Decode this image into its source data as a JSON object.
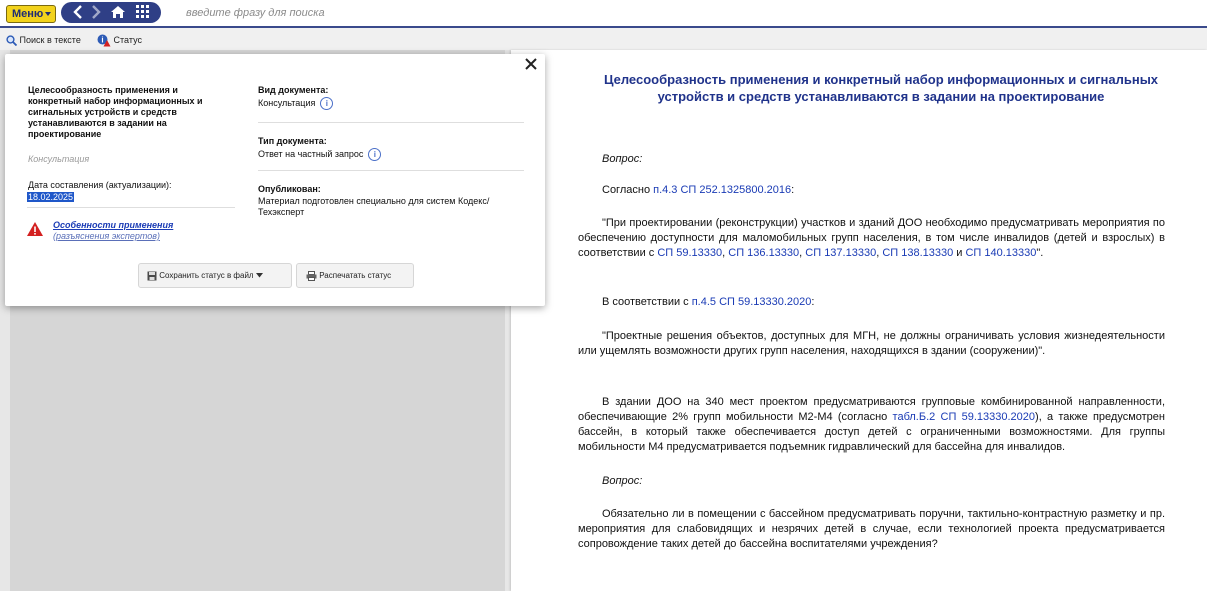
{
  "topbar": {
    "menu_label": "Меню",
    "search_placeholder": "введите фразу для поиска"
  },
  "toolbar": {
    "search_in_text": "Поиск в тексте",
    "status": "Статус"
  },
  "popup": {
    "doc_title": "Целесообразность применения и конкретный набор информационных и сигнальных устройств и средств устанавливаются в задании на проектирование",
    "doc_category": "Консультация",
    "date_label": "Дата составления (актуализации):",
    "date_value": "18.02.2025",
    "features_link": "Особенности применения",
    "features_sub": "(разъяснения экспертов)",
    "doc_kind_label": "Вид документа:",
    "doc_kind_value": "Консультация",
    "doc_type_label": "Тип документа:",
    "doc_type_value": "Ответ на частный запрос",
    "published_label": "Опубликован:",
    "published_value": "Материал подготовлен специально для систем Кодекс/Техэксперт",
    "save_button": "Сохранить статус в файл",
    "print_button": "Распечатать статус"
  },
  "document": {
    "title": "Целесообразность применения и конкретный набор информационных и сигнальных устройств и средств устанавливаются в задании на проектирование",
    "question1_label": "Вопрос:",
    "p1_prefix": "Согласно ",
    "p1_link": "п.4.3 СП 252.1325800.2016",
    "p1_suffix": ":",
    "p2_text": "\"При проектировании (реконструкции) участков и зданий ДОО необходимо предусматривать мероприятия по обеспечению доступности для маломобильных групп населения, в том числе инвалидов (детей и взрослых) в соответствии с ",
    "p2_link1": "СП 59.13330",
    "p2_link2": "СП 136.13330",
    "p2_link3": "СП 137.13330",
    "p2_link4": "СП 138.13330",
    "p2_and": " и ",
    "p2_link5": "СП 140.13330",
    "p2_end": "\".",
    "p3_prefix": "В соответствии с ",
    "p3_link": "п.4.5 СП 59.13330.2020",
    "p3_suffix": ":",
    "p4_text": "\"Проектные решения объектов, доступных для МГН, не должны ограничивать условия жизнедеятельности или ущемлять возможности других групп населения, находящихся в здании (сооружении)\".",
    "p5_text_a": "В здании ДОО на 340 мест проектом предусматриваются групповые комбинированной направленности, обеспечивающие 2% групп мобильности М2-М4 (согласно ",
    "p5_link": "табл.Б.2 СП 59.13330.2020",
    "p5_text_b": "), а также предусмотрен бассейн, в который также обеспечивается доступ детей с ограниченными возможностями. Для группы мобильности М4 предусматривается подъемник гидравлический для бассейна для инвалидов.",
    "question2_label": "Вопрос:",
    "p6_text": "Обязательно ли в помещении с бассейном предусматривать поручни, тактильно-контрастную разметку и пр. мероприятия для слабовидящих и незрячих детей в случае, если технологией проекта предусматривается сопровождение таких детей до бассейна воспитателями учреждения?"
  },
  "icons": {
    "back": "chevron-left-icon",
    "forward": "chevron-right-icon",
    "home": "home-icon",
    "grid": "grid-icon",
    "magnifier": "search-icon",
    "status": "status-icon",
    "warning": "warning-icon",
    "info": "info-icon",
    "close": "close-icon",
    "save": "floppy-icon",
    "print": "printer-icon"
  },
  "colors": {
    "accent_blue": "#20338b",
    "menu_yellow": "#f2d21c",
    "link_blue": "#1a3bb5",
    "link_orange": "#d8811e",
    "warning_red": "#d32020"
  }
}
